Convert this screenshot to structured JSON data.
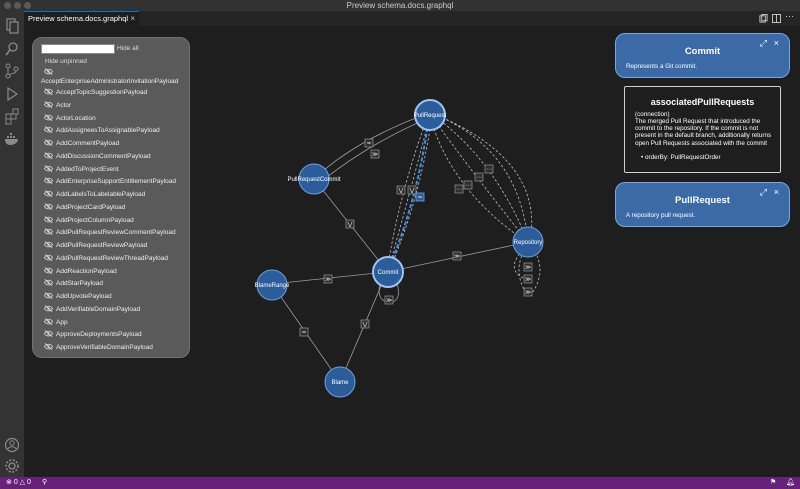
{
  "window": {
    "title": "Preview schema.docs.graphql"
  },
  "tab": {
    "label": "Preview schema.docs.graphql",
    "close": "×"
  },
  "activity": [
    "explorer-icon",
    "search-icon",
    "source-control-icon",
    "run-debug-icon",
    "extensions-icon",
    "docker-icon",
    "account-icon",
    "settings-gear-icon"
  ],
  "types_panel": {
    "search_value": "",
    "hide_all": "Hide all",
    "hide_unpinned": "Hide unpinned",
    "types": [
      "AcceptEnterpriseAdministratorInvitationPayload",
      "AcceptTopicSuggestionPayload",
      "Actor",
      "ActorLocation",
      "AddAssigneesToAssignablePayload",
      "AddCommentPayload",
      "AddDiscussionCommentPayload",
      "AddedToProjectEvent",
      "AddEnterpriseSupportEntitlementPayload",
      "AddLabelsToLabelablePayload",
      "AddProjectCardPayload",
      "AddProjectColumnPayload",
      "AddPullRequestReviewCommentPayload",
      "AddPullRequestReviewPayload",
      "AddPullRequestReviewThreadPayload",
      "AddReactionPayload",
      "AddStarPayload",
      "AddUpvotePayload",
      "AddVerifiableDomainPayload",
      "App",
      "ApproveDeploymentsPayload",
      "ApproveVerifiableDomainPayload"
    ]
  },
  "graph": {
    "nodes": {
      "pullrequest": "PullRequest",
      "pullrequestcommit": "PullRequestCommit",
      "repository": "Repository",
      "commit": "Commit",
      "blamerange": "BlameRange",
      "blame": "Blame"
    },
    "edge_icons": [
      "≈",
      "≫",
      "⋯",
      "⋁",
      "⋯"
    ]
  },
  "cards": {
    "commit": {
      "title": "Commit",
      "description": "Represents a Git commit."
    },
    "field": {
      "title": "associatedPullRequests",
      "kind": "(connection)",
      "description": "The merged Pull Request that introduced the commit to the repository. If the commit is not present in the default branch, additionally returns open Pull Requests associated with the commit",
      "arg": "orderBy: PullRequestOrder"
    },
    "pullrequest": {
      "title": "PullRequest",
      "description": "A repository pull request."
    },
    "expand": "⤢",
    "close": "×"
  },
  "statusbar": {
    "errors": "0",
    "warnings": "0"
  },
  "colors": {
    "node_fill": "#2a5d9a",
    "node_stroke": "#6ea0dc",
    "highlight_edge": "#3a8ee6",
    "status_bar": "#68217a"
  }
}
